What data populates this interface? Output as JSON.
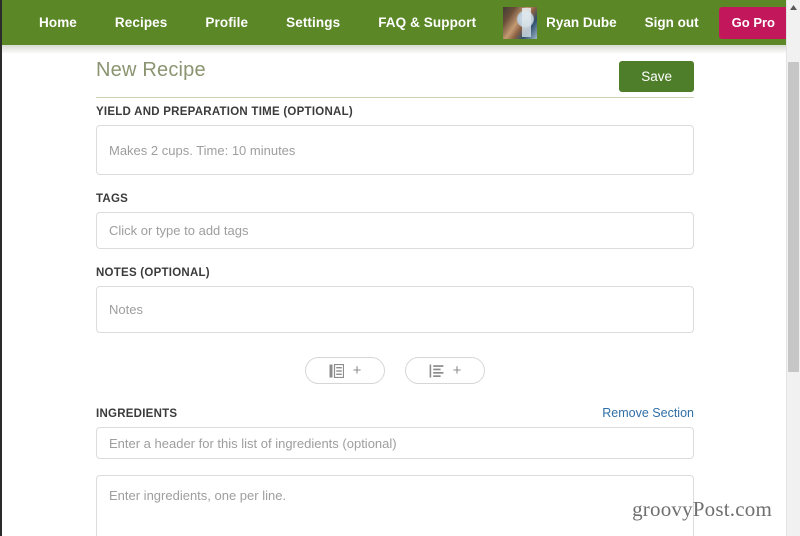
{
  "nav": {
    "links": [
      {
        "label": "Home",
        "name": "nav-home"
      },
      {
        "label": "Recipes",
        "name": "nav-recipes"
      },
      {
        "label": "Profile",
        "name": "nav-profile"
      },
      {
        "label": "Settings",
        "name": "nav-settings"
      },
      {
        "label": "FAQ & Support",
        "name": "nav-faq-support"
      }
    ],
    "username": "Ryan Dube",
    "signout_label": "Sign out",
    "gopro_label": "Go Pro",
    "avatar_icon": "user-avatar-photo",
    "background_color": "#5b8727",
    "gopro_color": "#c2185b"
  },
  "page": {
    "title": "New Recipe",
    "title_color": "#8a9470",
    "save_label": "Save",
    "save_color": "#4e7e2a"
  },
  "form": {
    "yield": {
      "label": "YIELD AND PREPARATION TIME (OPTIONAL)",
      "placeholder": "Makes 2 cups. Time: 10 minutes",
      "value": ""
    },
    "tags": {
      "label": "TAGS",
      "placeholder": "Click or type to add tags",
      "value": ""
    },
    "notes": {
      "label": "NOTES (OPTIONAL)",
      "placeholder": "Notes",
      "value": ""
    },
    "add_buttons": [
      {
        "icon": "add-section-icon",
        "plus": "+",
        "name": "add-section-button"
      },
      {
        "icon": "add-list-icon",
        "plus": "+",
        "name": "add-list-button"
      }
    ],
    "ingredients": {
      "label": "INGREDIENTS",
      "remove_label": "Remove Section",
      "remove_color": "#2f6fa8",
      "header_placeholder": "Enter a header for this list of ingredients (optional)",
      "header_value": "",
      "body_placeholder": "Enter ingredients, one per line.",
      "body_value": ""
    }
  },
  "watermark": {
    "text": "groovyPost.com"
  },
  "scrollbar": {
    "up_arrow_icon": "scroll-up-arrow-icon"
  }
}
